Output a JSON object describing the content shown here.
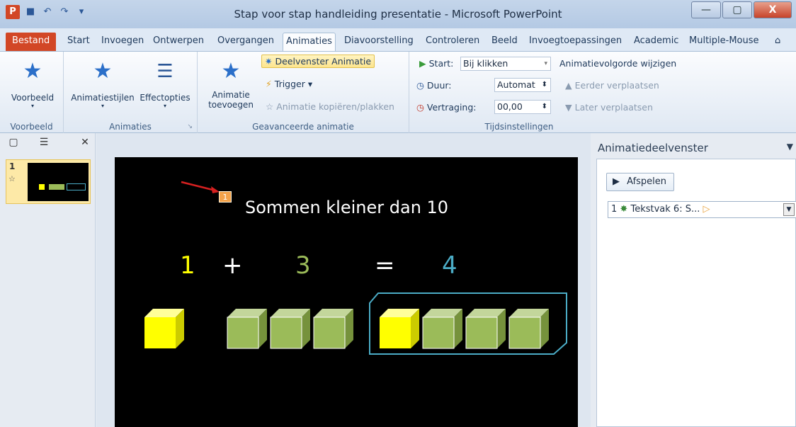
{
  "window": {
    "title": "Stap voor stap handleiding presentatie - Microsoft PowerPoint",
    "app_letter": "P",
    "minimize": "—",
    "maximize": "▢",
    "close": "X"
  },
  "tabs": [
    "Start",
    "Invoegen",
    "Ontwerpen",
    "Overgangen",
    "Animaties",
    "Diavoorstelling",
    "Controleren",
    "Beeld",
    "Invoegtoepassingen",
    "Academic",
    "Multiple-Mouse"
  ],
  "file_tab": "Bestand",
  "active_tab": "Animaties",
  "ribbon": {
    "voorbeeld": {
      "button": "Voorbeeld",
      "group": "Voorbeeld"
    },
    "animaties": {
      "stijlen": "Animatiestijlen",
      "opties": "Effectopties",
      "group": "Animaties"
    },
    "geavanceerd": {
      "toevoegen_1": "Animatie",
      "toevoegen_2": "toevoegen",
      "deelvenster": "Deelvenster Animatie",
      "trigger": "Trigger",
      "kopieren": "Animatie kopiëren/plakken",
      "group": "Geavanceerde animatie"
    },
    "timing": {
      "start_label": "Start:",
      "start_value": "Bij klikken",
      "duur_label": "Duur:",
      "duur_value": "Automat",
      "vertraging_label": "Vertraging:",
      "vertraging_value": "00,00",
      "volgorde": "Animatievolgorde wijzigen",
      "eerder": "Eerder verplaatsen",
      "later": "Later verplaatsen",
      "group": "Tijdsinstellingen"
    }
  },
  "slides_pane": {
    "slide_number": "1"
  },
  "slide": {
    "title": "Sommen kleiner dan 10",
    "anim_tag": "1",
    "eq_a": "1",
    "eq_plus": "+",
    "eq_b": "3",
    "eq_equals": "=",
    "eq_c": "4",
    "colors": {
      "yellow": "#ffff00",
      "green": "#9bbb59",
      "blue": "#4bacc6"
    }
  },
  "anim_pane": {
    "title": "Animatiedeelvenster",
    "play": "Afspelen",
    "item_number": "1",
    "item_label": "Tekstvak 6: S..."
  }
}
